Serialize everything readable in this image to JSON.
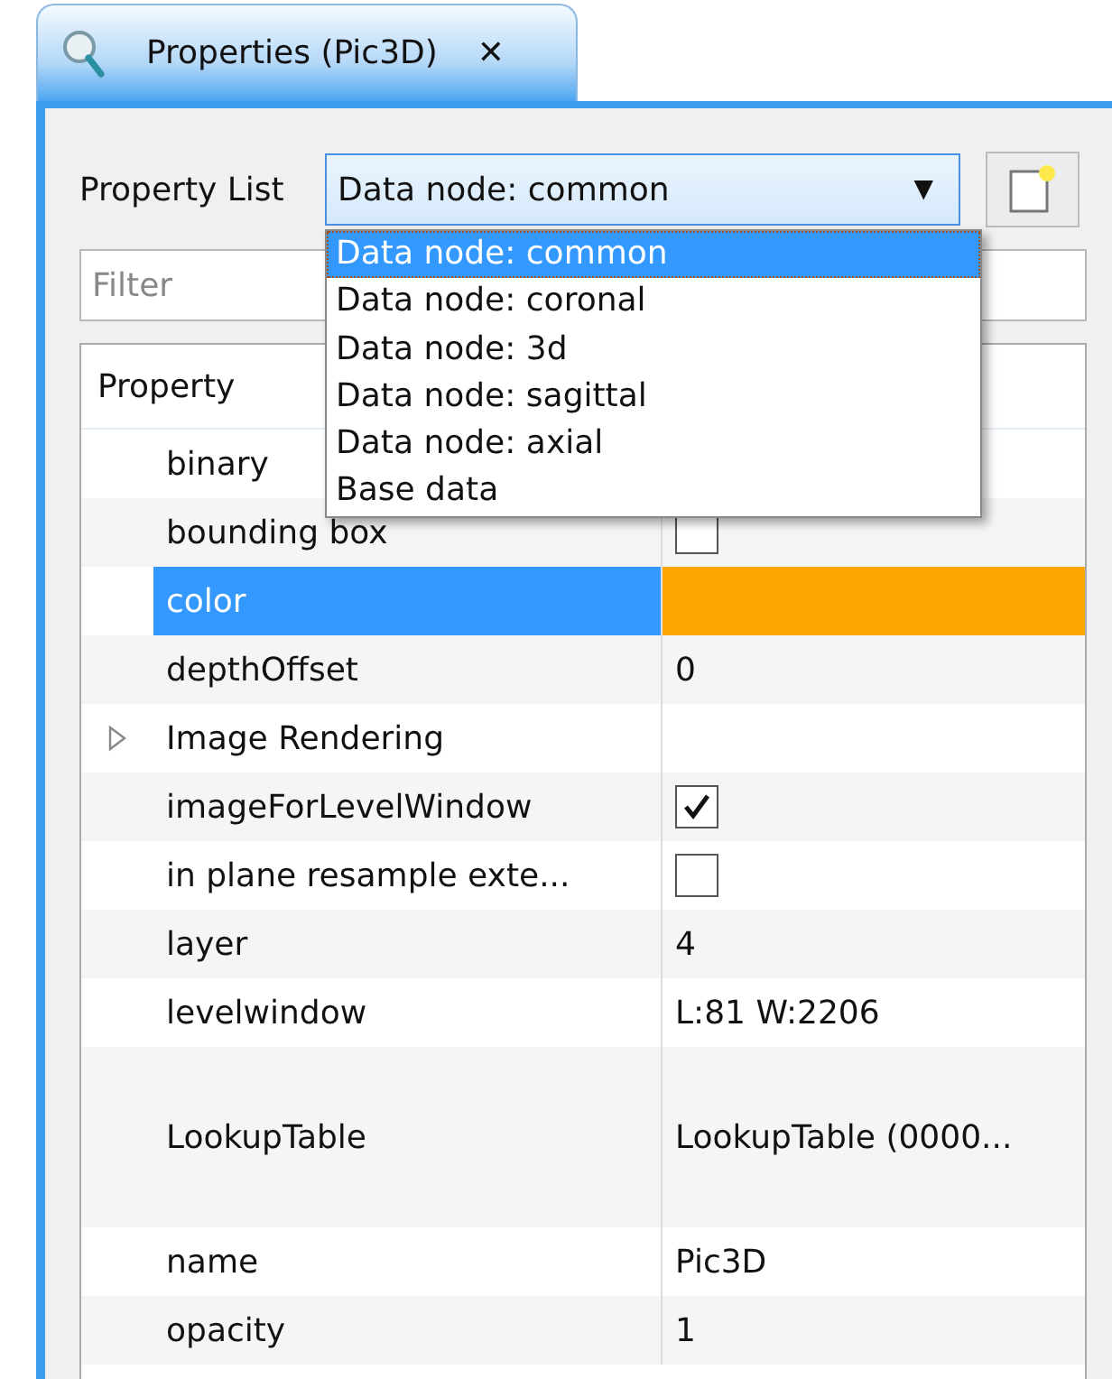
{
  "tab": {
    "title": "Properties (Pic3D)",
    "close": "✕",
    "selected": true
  },
  "property_list": {
    "label": "Property List",
    "value": "Data node: common",
    "arrow": "▼",
    "expanded": true,
    "options": [
      {
        "label": "Data node: common",
        "selected": true
      },
      {
        "label": "Data node: coronal",
        "selected": false
      },
      {
        "label": "Data node: 3d",
        "selected": false
      },
      {
        "label": "Data node: sagittal",
        "selected": false
      },
      {
        "label": "Data node: axial",
        "selected": false
      },
      {
        "label": "Base data",
        "selected": false
      }
    ]
  },
  "filter": {
    "placeholder": "Filter"
  },
  "table": {
    "columns": [
      "Property"
    ],
    "rows": [
      {
        "name": "binary",
        "kind": "hidden",
        "selected": false
      },
      {
        "name": "bounding box",
        "kind": "checkbox",
        "checked": false,
        "selected": false
      },
      {
        "name": "color",
        "kind": "color",
        "color": "#ffa500",
        "selected": true
      },
      {
        "name": "depthOffset",
        "kind": "text",
        "value": "0",
        "selected": false
      },
      {
        "name": "Image Rendering",
        "kind": "group",
        "expanded": false,
        "selected": false
      },
      {
        "name": "imageForLevelWindow",
        "kind": "checkbox",
        "checked": true,
        "selected": false
      },
      {
        "name": "in plane resample exte...",
        "kind": "checkbox",
        "checked": false,
        "selected": false
      },
      {
        "name": "layer",
        "kind": "text",
        "value": "4",
        "selected": false
      },
      {
        "name": "levelwindow",
        "kind": "text",
        "value": "L:81 W:2206",
        "selected": false
      },
      {
        "name": "LookupTable",
        "kind": "tall",
        "value": "LookupTable (0000...",
        "selected": false
      },
      {
        "name": "name",
        "kind": "text",
        "value": "Pic3D",
        "selected": false
      },
      {
        "name": "opacity",
        "kind": "text",
        "value": "1",
        "selected": false
      }
    ]
  }
}
